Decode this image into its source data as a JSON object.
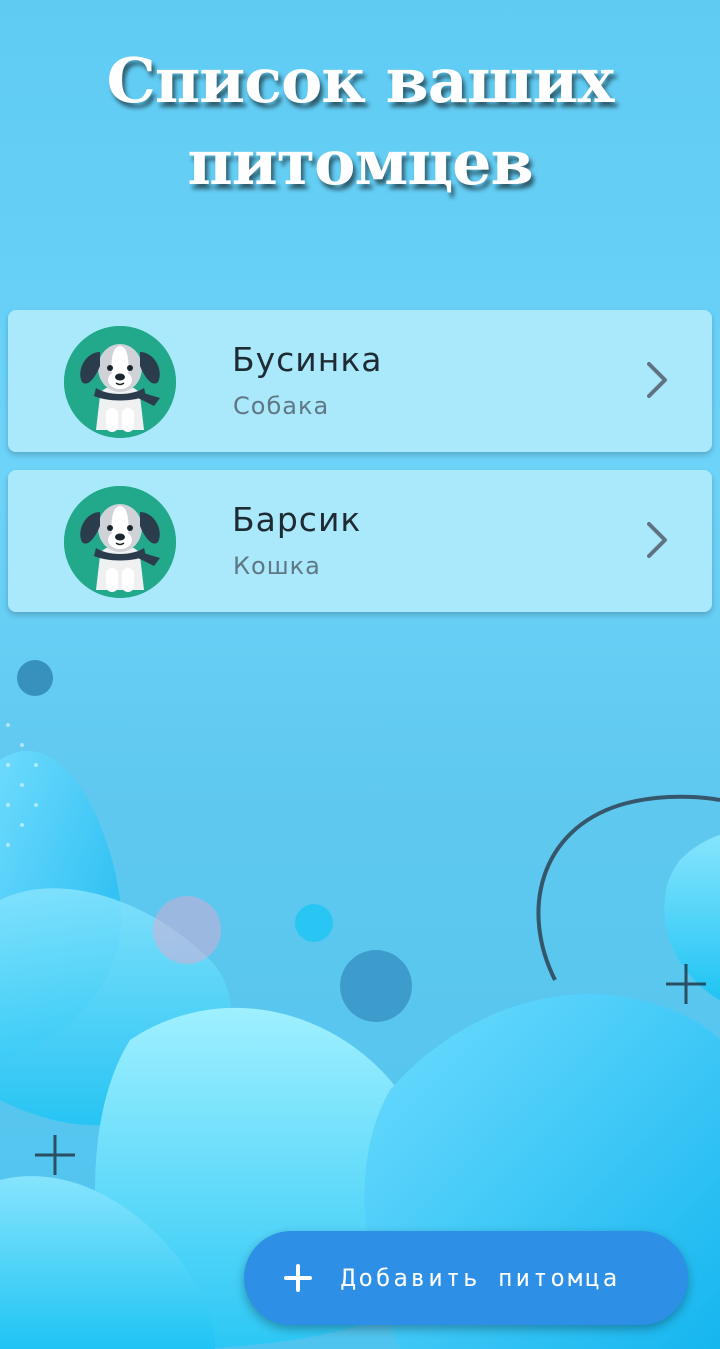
{
  "header": {
    "title_line1": "Список ваших",
    "title_line2": "питомцев"
  },
  "pets": [
    {
      "name": "Бусинка",
      "type": "Собака",
      "avatar_icon": "dog-avatar-icon"
    },
    {
      "name": "Барсик",
      "type": "Кошка",
      "avatar_icon": "dog-avatar-icon"
    }
  ],
  "fab": {
    "label": "Добавить питомца",
    "icon": "plus-icon"
  },
  "colors": {
    "card_background": "#aae8fc",
    "fab_background": "#2d8fe6",
    "avatar_background": "#22a98c",
    "title_color": "#ffffff"
  }
}
